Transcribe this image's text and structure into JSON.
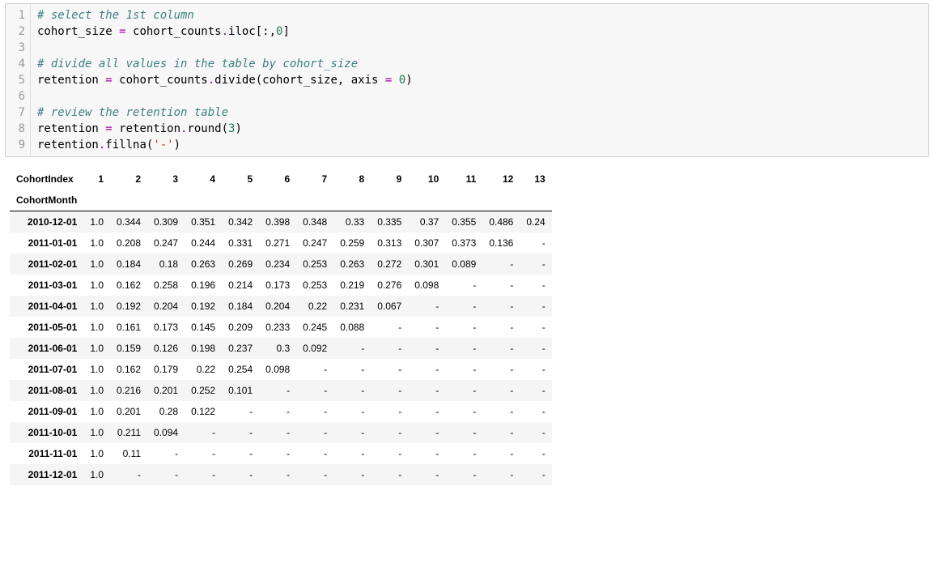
{
  "code": {
    "lines": [
      {
        "n": "1",
        "kind": "comment",
        "text": "# select the 1st column"
      },
      {
        "n": "2",
        "kind": "code",
        "ident": "cohort_size",
        "op1": " = ",
        "rest": "cohort_counts.iloc[:,0]",
        "num": "0"
      },
      {
        "n": "3",
        "kind": "blank",
        "text": ""
      },
      {
        "n": "4",
        "kind": "comment",
        "text": "# divide all values in the table by cohort_size"
      },
      {
        "n": "5",
        "kind": "code2",
        "ident": "retention",
        "op1": " = ",
        "mid": "cohort_counts.divide(cohort_size, axis ",
        "op2": "=",
        "num": " 0",
        ")": ")"
      },
      {
        "n": "6",
        "kind": "blank",
        "text": ""
      },
      {
        "n": "7",
        "kind": "comment",
        "text": "# review the retention table"
      },
      {
        "n": "8",
        "kind": "code3",
        "ident": "retention",
        "op1": " = ",
        "mid": "retention.round(",
        "num": "3",
        ")": ")"
      },
      {
        "n": "9",
        "kind": "code4",
        "ident": "retention",
        "mid": ".fillna(",
        "str": "'-'",
        ")": ")"
      }
    ]
  },
  "table": {
    "columns_label": "CohortIndex",
    "index_label": "CohortMonth",
    "columns": [
      "1",
      "2",
      "3",
      "4",
      "5",
      "6",
      "7",
      "8",
      "9",
      "10",
      "11",
      "12",
      "13"
    ],
    "rows": [
      {
        "idx": "2010-12-01",
        "cells": [
          "1.0",
          "0.344",
          "0.309",
          "0.351",
          "0.342",
          "0.398",
          "0.348",
          "0.33",
          "0.335",
          "0.37",
          "0.355",
          "0.486",
          "0.24"
        ]
      },
      {
        "idx": "2011-01-01",
        "cells": [
          "1.0",
          "0.208",
          "0.247",
          "0.244",
          "0.331",
          "0.271",
          "0.247",
          "0.259",
          "0.313",
          "0.307",
          "0.373",
          "0.136",
          "-"
        ]
      },
      {
        "idx": "2011-02-01",
        "cells": [
          "1.0",
          "0.184",
          "0.18",
          "0.263",
          "0.269",
          "0.234",
          "0.253",
          "0.263",
          "0.272",
          "0.301",
          "0.089",
          "-",
          "-"
        ]
      },
      {
        "idx": "2011-03-01",
        "cells": [
          "1.0",
          "0.162",
          "0.258",
          "0.196",
          "0.214",
          "0.173",
          "0.253",
          "0.219",
          "0.276",
          "0.098",
          "-",
          "-",
          "-"
        ]
      },
      {
        "idx": "2011-04-01",
        "cells": [
          "1.0",
          "0.192",
          "0.204",
          "0.192",
          "0.184",
          "0.204",
          "0.22",
          "0.231",
          "0.067",
          "-",
          "-",
          "-",
          "-"
        ]
      },
      {
        "idx": "2011-05-01",
        "cells": [
          "1.0",
          "0.161",
          "0.173",
          "0.145",
          "0.209",
          "0.233",
          "0.245",
          "0.088",
          "-",
          "-",
          "-",
          "-",
          "-"
        ]
      },
      {
        "idx": "2011-06-01",
        "cells": [
          "1.0",
          "0.159",
          "0.126",
          "0.198",
          "0.237",
          "0.3",
          "0.092",
          "-",
          "-",
          "-",
          "-",
          "-",
          "-"
        ]
      },
      {
        "idx": "2011-07-01",
        "cells": [
          "1.0",
          "0.162",
          "0.179",
          "0.22",
          "0.254",
          "0.098",
          "-",
          "-",
          "-",
          "-",
          "-",
          "-",
          "-"
        ]
      },
      {
        "idx": "2011-08-01",
        "cells": [
          "1.0",
          "0.216",
          "0.201",
          "0.252",
          "0.101",
          "-",
          "-",
          "-",
          "-",
          "-",
          "-",
          "-",
          "-"
        ]
      },
      {
        "idx": "2011-09-01",
        "cells": [
          "1.0",
          "0.201",
          "0.28",
          "0.122",
          "-",
          "-",
          "-",
          "-",
          "-",
          "-",
          "-",
          "-",
          "-"
        ]
      },
      {
        "idx": "2011-10-01",
        "cells": [
          "1.0",
          "0.211",
          "0.094",
          "-",
          "-",
          "-",
          "-",
          "-",
          "-",
          "-",
          "-",
          "-",
          "-"
        ]
      },
      {
        "idx": "2011-11-01",
        "cells": [
          "1.0",
          "0.11",
          "-",
          "-",
          "-",
          "-",
          "-",
          "-",
          "-",
          "-",
          "-",
          "-",
          "-"
        ]
      },
      {
        "idx": "2011-12-01",
        "cells": [
          "1.0",
          "-",
          "-",
          "-",
          "-",
          "-",
          "-",
          "-",
          "-",
          "-",
          "-",
          "-",
          "-"
        ]
      }
    ]
  }
}
